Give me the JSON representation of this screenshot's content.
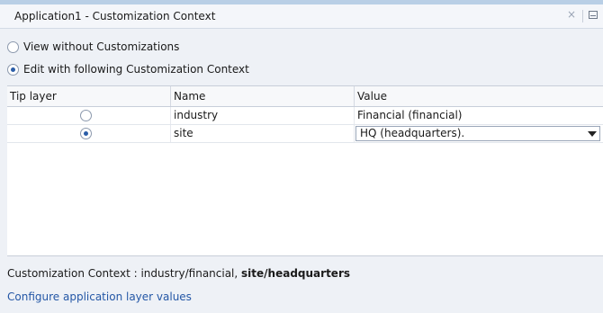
{
  "window": {
    "title": "Application1 - Customization Context",
    "close_glyph": "×"
  },
  "options": {
    "view_without": "View without Customizations",
    "edit_with": "Edit with following Customization Context",
    "selected": "edit_with"
  },
  "table": {
    "headers": [
      "Tip layer",
      "Name",
      "Value"
    ],
    "rows": [
      {
        "tip_layer": false,
        "name": "industry",
        "value": "Financial (financial)",
        "editable": false
      },
      {
        "tip_layer": true,
        "name": "site",
        "value": "HQ (headquarters).",
        "editable": true
      }
    ]
  },
  "footer": {
    "context_prefix": "Customization Context : ",
    "context_plain": "industry/financial, ",
    "context_bold": "site/headquarters",
    "configure_link": "Configure application layer values"
  },
  "colors": {
    "panel_bg": "#eef1f6",
    "link": "#2457a6",
    "radio_dot": "#2c5ea8"
  }
}
